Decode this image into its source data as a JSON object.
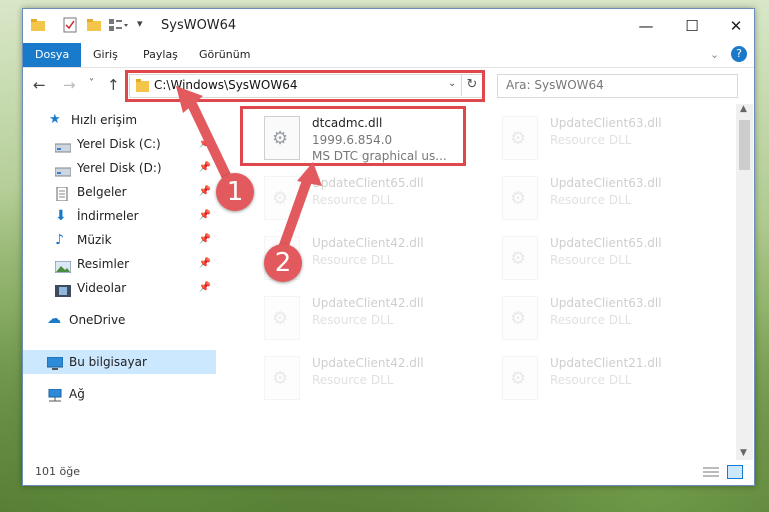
{
  "window": {
    "title": "SysWOW64",
    "controls": {
      "minimize": "—",
      "maximize": "☐",
      "close": "✕"
    }
  },
  "ribbon": {
    "tabs": [
      "Dosya",
      "Giriş",
      "Paylaş",
      "Görünüm"
    ],
    "collapse_icon": "chevron-down-icon",
    "help_icon": "help-icon"
  },
  "address": {
    "path": "C:\\Windows\\SysWOW64",
    "search_placeholder": "Ara: SysWOW64"
  },
  "sidebar": {
    "quick_access": "Hızlı erişim",
    "items": [
      {
        "label": "Yerel Disk (C:)",
        "pinned": true
      },
      {
        "label": "Yerel Disk (D:)",
        "pinned": true
      },
      {
        "label": "Belgeler",
        "pinned": true
      },
      {
        "label": "İndirmeler",
        "pinned": true
      },
      {
        "label": "Müzik",
        "pinned": true
      },
      {
        "label": "Resimler",
        "pinned": true
      },
      {
        "label": "Videolar",
        "pinned": true
      }
    ],
    "onedrive": "OneDrive",
    "this_pc": "Bu bilgisayar",
    "network": "Ağ"
  },
  "files": [
    {
      "name": "dtcadmc.dll",
      "line2": "1999.6.854.0",
      "line3": "MS DTC graphical us...",
      "highlight": true
    },
    {
      "name": "UpdateClient63.dll",
      "line2": "Resource DLL"
    },
    {
      "name": "UpdateClient65.dll",
      "line2": "Resource DLL"
    },
    {
      "name": "UpdateClient63.dll",
      "line2": "Resource DLL"
    },
    {
      "name": "UpdateClient42.dll",
      "line2": "Resource DLL"
    },
    {
      "name": "UpdateClient65.dll",
      "line2": "Resource DLL"
    },
    {
      "name": "UpdateClient42.dll",
      "line2": "Resource DLL"
    },
    {
      "name": "UpdateClient63.dll",
      "line2": "Resource DLL"
    },
    {
      "name": "UpdateClient42.dll",
      "line2": "Resource DLL"
    },
    {
      "name": "UpdateClient21.dll",
      "line2": "Resource DLL"
    }
  ],
  "status": {
    "count": "101 öğe"
  },
  "callouts": {
    "one": "1",
    "two": "2"
  },
  "colors": {
    "accent": "#1979ca",
    "highlight": "#e0474c",
    "badge": "#e25a5d"
  }
}
